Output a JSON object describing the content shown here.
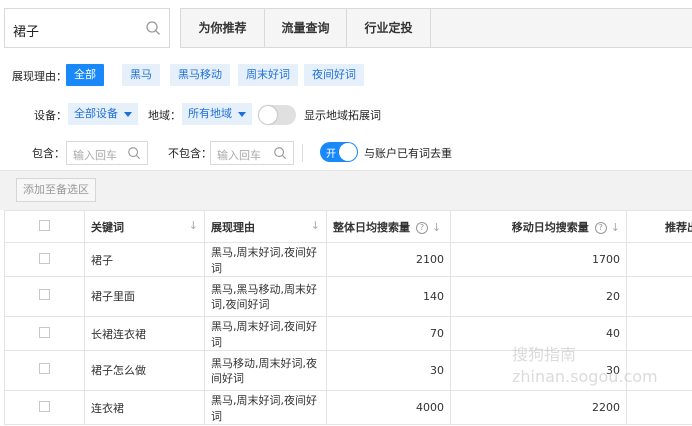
{
  "search": {
    "value": "裙子"
  },
  "tabs": [
    "为你推荐",
    "流量查询",
    "行业定投"
  ],
  "reason": {
    "label": "展现理由：",
    "tags": [
      "全部",
      "黑马",
      "黑马移动",
      "周末好词",
      "夜间好词"
    ]
  },
  "device": {
    "label": "设备：",
    "value": "全部设备",
    "region_label": "地域：",
    "region_value": "所有地域",
    "toggle_label": "显示地域拓展词"
  },
  "filter": {
    "include_label": "包含：",
    "include_placeholder": "输入回车",
    "exclude_label": "不包含：",
    "exclude_placeholder": "输入回车",
    "toggle_on_text": "开",
    "toggle_label": "与账户已有词去重"
  },
  "actions": {
    "add_label": "添加至备选区"
  },
  "table": {
    "headers": [
      "关键词",
      "展现理由",
      "整体日均搜索量",
      "移动日均搜索量",
      "推荐出"
    ],
    "rows": [
      {
        "keyword": "裙子",
        "reason": "黑马,周末好词,夜间好词",
        "total": "2100",
        "mobile": "1700"
      },
      {
        "keyword": "裙子里面",
        "reason": "黑马,黑马移动,周末好词,夜间好词",
        "total": "140",
        "mobile": "20"
      },
      {
        "keyword": "长裙连衣裙",
        "reason": "黑马,周末好词,夜间好词",
        "total": "70",
        "mobile": "40"
      },
      {
        "keyword": "裙子怎么做",
        "reason": "黑马移动,周末好词,夜间好词",
        "total": "30",
        "mobile": "30"
      },
      {
        "keyword": "连衣裙",
        "reason": "黑马,周末好词,夜间好词",
        "total": "4000",
        "mobile": "2200"
      }
    ]
  },
  "watermark": "搜狗指南 zhinan.sogou.com"
}
